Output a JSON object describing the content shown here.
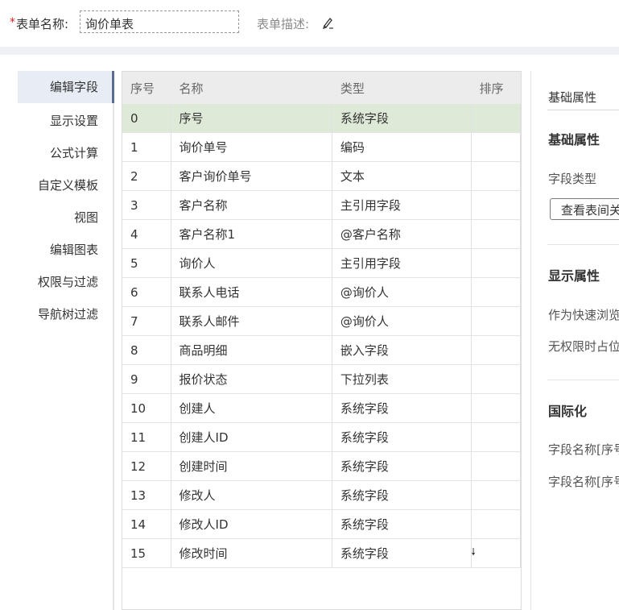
{
  "header": {
    "required_mark": "*",
    "name_label": "表单名称:",
    "name_value": "询价单表",
    "desc_label": "表单描述:",
    "edit_icon": "pencil-icon"
  },
  "sidebar": {
    "items": [
      {
        "label": "编辑字段",
        "active": true
      },
      {
        "label": "显示设置"
      },
      {
        "label": "公式计算"
      },
      {
        "label": "自定义模板"
      },
      {
        "label": "视图"
      },
      {
        "label": "编辑图表"
      },
      {
        "label": "权限与过滤"
      },
      {
        "label": "导航树过滤"
      }
    ]
  },
  "table": {
    "columns": [
      "序号",
      "名称",
      "类型",
      "排序"
    ],
    "rows": [
      {
        "idx": "0",
        "name": "序号",
        "type": "系统字段"
      },
      {
        "idx": "1",
        "name": "询价单号",
        "type": "编码"
      },
      {
        "idx": "2",
        "name": "客户询价单号",
        "type": "文本"
      },
      {
        "idx": "3",
        "name": "客户名称",
        "type": "主引用字段"
      },
      {
        "idx": "4",
        "name": "客户名称1",
        "type": "@客户名称"
      },
      {
        "idx": "5",
        "name": "询价人",
        "type": "主引用字段"
      },
      {
        "idx": "6",
        "name": "联系人电话",
        "type": "@询价人"
      },
      {
        "idx": "7",
        "name": "联系人邮件",
        "type": "@询价人"
      },
      {
        "idx": "8",
        "name": "商品明细",
        "type": "嵌入字段"
      },
      {
        "idx": "9",
        "name": "报价状态",
        "type": "下拉列表"
      },
      {
        "idx": "10",
        "name": "创建人",
        "type": "系统字段"
      },
      {
        "idx": "11",
        "name": "创建人ID",
        "type": "系统字段"
      },
      {
        "idx": "12",
        "name": "创建时间",
        "type": "系统字段"
      },
      {
        "idx": "13",
        "name": "修改人",
        "type": "系统字段"
      },
      {
        "idx": "14",
        "name": "修改人ID",
        "type": "系统字段"
      },
      {
        "idx": "15",
        "name": "修改时间",
        "type": "系统字段",
        "sort": "🠗"
      }
    ],
    "selected_row": 0
  },
  "right_panel": {
    "tab": "基础属性",
    "section1_title": "基础属性",
    "field_type_label": "字段类型",
    "view_relation_button": "查看表间关系",
    "section2_title": "显示属性",
    "quick_browse_label": "作为快速浏览",
    "no_permission_label": "无权限时占位",
    "section3_title": "国际化",
    "field_name_1": "字段名称[序号]",
    "field_name_2": "字段名称[序号]"
  }
}
